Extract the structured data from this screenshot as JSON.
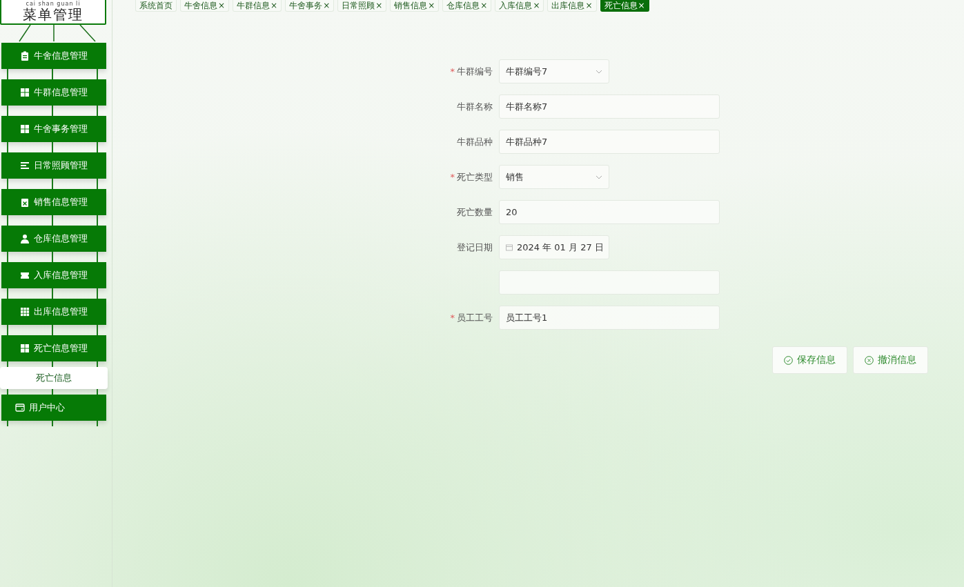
{
  "menu_header": {
    "pinyin": "cai shan guan li",
    "title": "菜单管理"
  },
  "menu": [
    {
      "label": "牛舍信息管理",
      "kind": "group",
      "selected": false
    },
    {
      "label": "牛群信息管理",
      "kind": "group",
      "selected": false
    },
    {
      "label": "牛舍事务管理",
      "kind": "group",
      "selected": false
    },
    {
      "label": "日常照顾管理",
      "kind": "group",
      "selected": false
    },
    {
      "label": "销售信息管理",
      "kind": "group",
      "selected": false
    },
    {
      "label": "仓库信息管理",
      "kind": "group",
      "selected": false
    },
    {
      "label": "入库信息管理",
      "kind": "group",
      "selected": false
    },
    {
      "label": "出库信息管理",
      "kind": "group",
      "selected": false
    },
    {
      "label": "死亡信息管理",
      "kind": "group",
      "selected": false
    },
    {
      "label": "死亡信息",
      "kind": "sub",
      "selected": true
    },
    {
      "label": "用户中心",
      "kind": "group",
      "selected": false
    }
  ],
  "tabs": [
    {
      "label": "系统首页",
      "selected": false
    },
    {
      "label": "牛舍信息",
      "close": "×",
      "selected": false
    },
    {
      "label": "牛群信息",
      "close": "×",
      "selected": false
    },
    {
      "label": "牛舍事务",
      "close": "×",
      "selected": false
    },
    {
      "label": "日常照顾",
      "close": "×",
      "selected": false
    },
    {
      "label": "销售信息",
      "close": "×",
      "selected": false
    },
    {
      "label": "仓库信息",
      "close": "×",
      "selected": false
    },
    {
      "label": "入库信息",
      "close": "×",
      "selected": false
    },
    {
      "label": "出库信息",
      "close": "×",
      "selected": false
    },
    {
      "label": "死亡信息",
      "close": "×",
      "selected": true
    }
  ],
  "form": {
    "fields": [
      {
        "label": "牛群编号",
        "mark": "*",
        "kind": "select",
        "value": "牛群编号7"
      },
      {
        "label": "牛群名称",
        "kind": "text",
        "value": "牛群名称7"
      },
      {
        "label": "牛群品种",
        "kind": "text",
        "value": "牛群品种7"
      },
      {
        "label": "死亡类型",
        "mark": "*",
        "kind": "select",
        "value": "销售"
      },
      {
        "label": "死亡数量",
        "kind": "text",
        "value": "20"
      },
      {
        "label": "登记日期",
        "kind": "date",
        "value": "2024 年 01 月 27 日"
      },
      {
        "kind": "text"
      },
      {
        "label": "员工工号",
        "mark": "*",
        "kind": "text",
        "value": "员工工号1"
      }
    ],
    "buttons": [
      {
        "label": "保存信息",
        "kind": "save"
      },
      {
        "label": "撤消信息",
        "kind": "cancel"
      }
    ]
  }
}
